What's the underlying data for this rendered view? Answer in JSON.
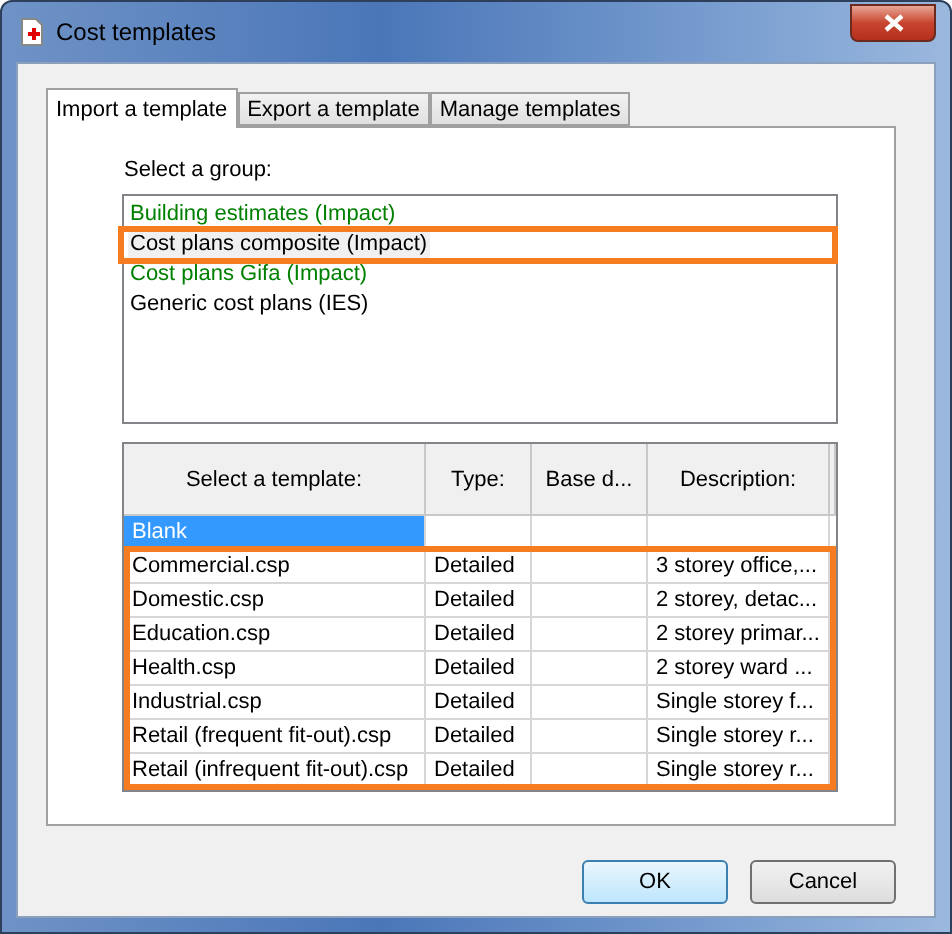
{
  "window": {
    "title": "Cost templates"
  },
  "tabs": [
    {
      "label": "Import a template",
      "selected": true
    },
    {
      "label": "Export a template",
      "selected": false
    },
    {
      "label": "Manage templates",
      "selected": false
    }
  ],
  "group_label": "Select a group:",
  "groups": [
    {
      "label": "Building estimates (Impact)",
      "color": "#008000",
      "selected": false,
      "highlighted": false
    },
    {
      "label": "Cost plans composite (Impact)",
      "color": "#000000",
      "selected": true,
      "highlighted": true
    },
    {
      "label": "Cost plans Gifa (Impact)",
      "color": "#008000",
      "selected": false,
      "highlighted": false
    },
    {
      "label": "Generic cost plans (IES)",
      "color": "#000000",
      "selected": false,
      "highlighted": false
    }
  ],
  "table": {
    "columns": [
      "Select a template:",
      "Type:",
      "Base d...",
      "Description:"
    ],
    "rows": [
      {
        "cells": [
          "Blank",
          "",
          "",
          ""
        ],
        "selected": true,
        "highlighted": false
      },
      {
        "cells": [
          "Commercial.csp",
          "Detailed",
          "",
          "3 storey office,..."
        ],
        "selected": false,
        "highlighted": true
      },
      {
        "cells": [
          "Domestic.csp",
          "Detailed",
          "",
          "2 storey, detac..."
        ],
        "selected": false,
        "highlighted": true
      },
      {
        "cells": [
          "Education.csp",
          "Detailed",
          "",
          "2 storey primar..."
        ],
        "selected": false,
        "highlighted": true
      },
      {
        "cells": [
          "Health.csp",
          "Detailed",
          "",
          "2 storey ward ..."
        ],
        "selected": false,
        "highlighted": true
      },
      {
        "cells": [
          "Industrial.csp",
          "Detailed",
          "",
          "Single storey f..."
        ],
        "selected": false,
        "highlighted": true
      },
      {
        "cells": [
          "Retail (frequent fit-out).csp",
          "Detailed",
          "",
          "Single storey r..."
        ],
        "selected": false,
        "highlighted": true
      },
      {
        "cells": [
          "Retail (infrequent fit-out).csp",
          "Detailed",
          "",
          "Single storey r..."
        ],
        "selected": false,
        "highlighted": true
      }
    ]
  },
  "buttons": [
    {
      "label": "OK",
      "default": true
    },
    {
      "label": "Cancel",
      "default": false
    }
  ]
}
